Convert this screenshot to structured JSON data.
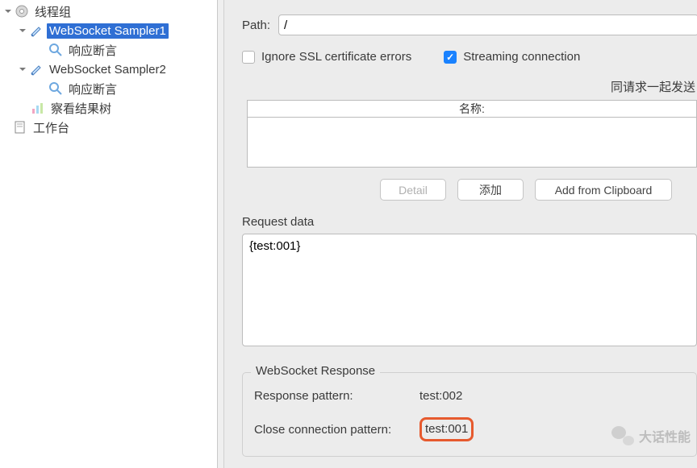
{
  "tree": {
    "thread_group": "线程组",
    "sampler1": "WebSocket Sampler1",
    "assertion1": "响应断言",
    "sampler2": "WebSocket Sampler2",
    "assertion2": "响应断言",
    "result_tree": "察看结果树",
    "workbench": "工作台"
  },
  "form": {
    "path_label": "Path:",
    "path_value": "/",
    "ignore_ssl": "Ignore SSL certificate errors",
    "streaming": "Streaming connection",
    "send_with_request": "同请求一起发送",
    "col_name": "名称:",
    "btn_detail": "Detail",
    "btn_add": "添加",
    "btn_clipboard": "Add from Clipboard",
    "request_data_label": "Request data",
    "request_data_value": "{test:001}",
    "ws_response_title": "WebSocket Response",
    "response_pattern_label": "Response pattern:",
    "response_pattern_value": "test:002",
    "close_pattern_label": "Close connection pattern:",
    "close_pattern_value": "test:001"
  },
  "watermark": "大话性能"
}
